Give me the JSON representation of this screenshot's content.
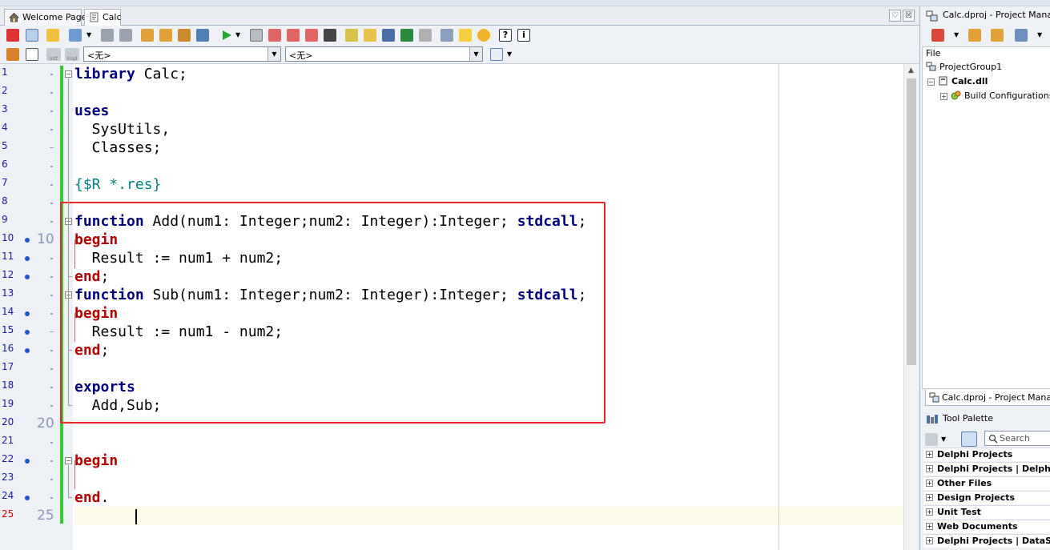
{
  "tabs": {
    "welcome_label": "Welcome Page",
    "calc_label": "Calc",
    "menu_glyph": "♡",
    "close_glyph": "☒"
  },
  "toolbar": {
    "unit_combo_value": "<无>",
    "method_combo_value": "<无>",
    "intf_label": "Intf",
    "impl_label": "Impl",
    "combo_arrow": "▼"
  },
  "editor": {
    "line_numbers": [
      "1",
      "2",
      "3",
      "4",
      "5",
      "6",
      "7",
      "8",
      "9",
      "10",
      "11",
      "12",
      "13",
      "14",
      "15",
      "16",
      "17",
      "18",
      "19",
      "20",
      "21",
      "22",
      "23",
      "24",
      "25"
    ],
    "big_markers": [
      "10",
      "20",
      "25"
    ],
    "lines": [
      [
        {
          "t": "library",
          "c": "kw"
        },
        {
          "t": " Calc;",
          "c": "plain"
        }
      ],
      [],
      [
        {
          "t": "uses",
          "c": "kw"
        }
      ],
      [
        {
          "t": "  SysUtils,",
          "c": "plain"
        }
      ],
      [
        {
          "t": "  Classes;",
          "c": "plain"
        }
      ],
      [],
      [
        {
          "t": "{$R *.res}",
          "c": "dir"
        }
      ],
      [],
      [
        {
          "t": "function",
          "c": "kw"
        },
        {
          "t": " Add(num1: Integer;num2: Integer):Integer; ",
          "c": "plain"
        },
        {
          "t": "stdcall",
          "c": "kw"
        },
        {
          "t": ";",
          "c": "plain"
        }
      ],
      [
        {
          "t": "begin",
          "c": "kr"
        }
      ],
      [
        {
          "t": "  Result := num1 + num2;",
          "c": "plain"
        }
      ],
      [
        {
          "t": "end",
          "c": "kr"
        },
        {
          "t": ";",
          "c": "plain"
        }
      ],
      [
        {
          "t": "function",
          "c": "kw"
        },
        {
          "t": " Sub(num1: Integer;num2: Integer):Integer; ",
          "c": "plain"
        },
        {
          "t": "stdcall",
          "c": "kw"
        },
        {
          "t": ";",
          "c": "plain"
        }
      ],
      [
        {
          "t": "begin",
          "c": "kr"
        }
      ],
      [
        {
          "t": "  Result := num1 - num2;",
          "c": "plain"
        }
      ],
      [
        {
          "t": "end",
          "c": "kr"
        },
        {
          "t": ";",
          "c": "plain"
        }
      ],
      [],
      [
        {
          "t": "exports",
          "c": "kw"
        }
      ],
      [
        {
          "t": "  Add,Sub;",
          "c": "plain"
        }
      ],
      [],
      [],
      [
        {
          "t": "begin",
          "c": "kr"
        }
      ],
      [],
      [
        {
          "t": "end",
          "c": "kr"
        },
        {
          "t": ".",
          "c": "plain"
        }
      ],
      []
    ],
    "current_line": 25,
    "breakpoint_lines": [
      10,
      11,
      12,
      14,
      15,
      16,
      22,
      24
    ]
  },
  "project_manager": {
    "title": "Calc.dproj - Project Manager",
    "column_header": "File",
    "tree": {
      "group": "ProjectGroup1",
      "project": "Calc.dll",
      "build_configs": "Build Configurations"
    },
    "bottom_tab": "Calc.dproj - Project Manager"
  },
  "tool_palette": {
    "title": "Tool Palette",
    "search_placeholder": "Search",
    "categories": [
      "Delphi Projects",
      "Delphi Projects | Delphi Files",
      "Other Files",
      "Design Projects",
      "Unit Test",
      "Web Documents",
      "Delphi Projects | DataSnap Server"
    ]
  },
  "colors": {
    "keyword": "#00007a",
    "begin_end": "#b00000",
    "directive": "#008080",
    "highlight_box": "#e8262a",
    "change_bar": "#33cc33"
  }
}
